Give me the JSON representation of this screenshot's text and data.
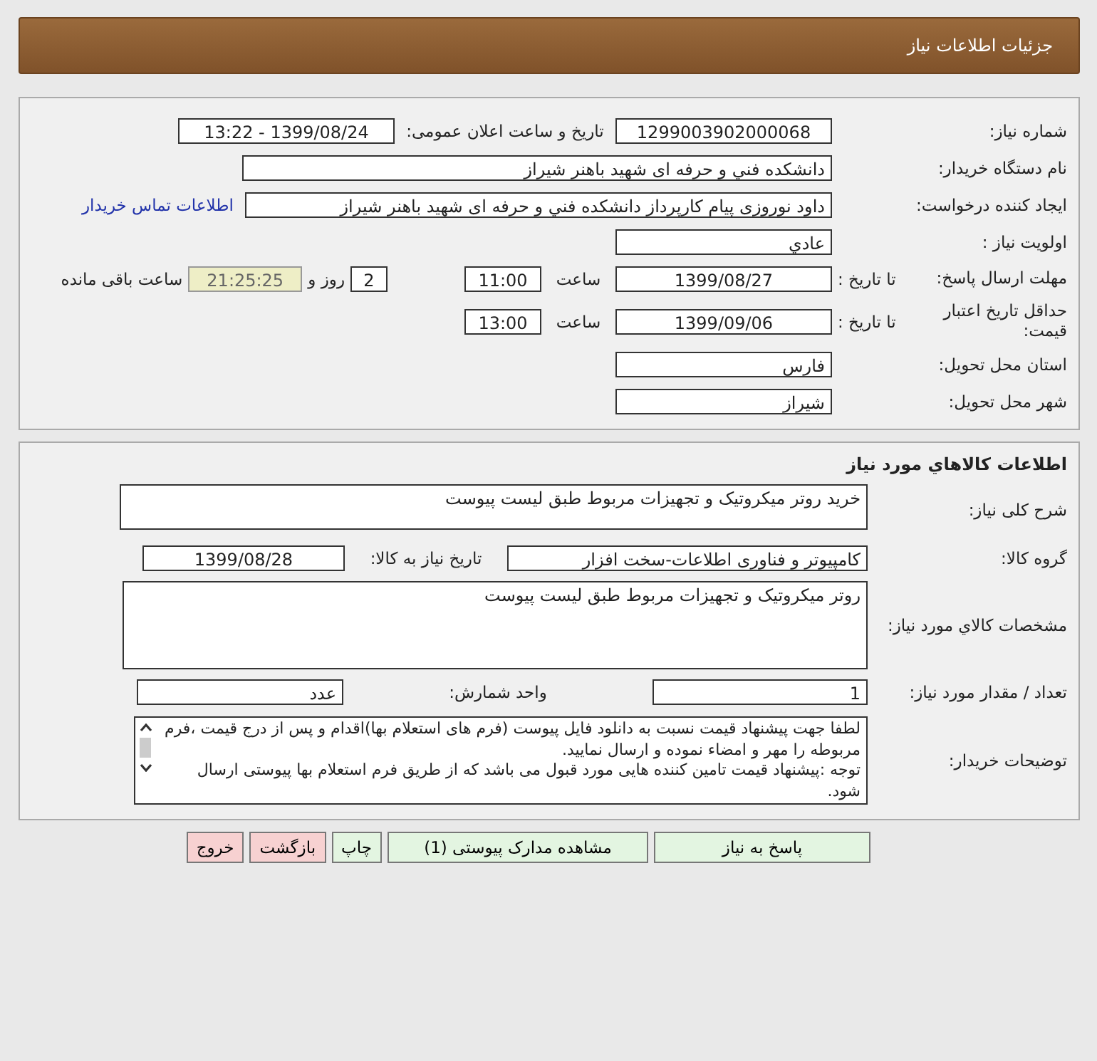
{
  "header": {
    "title": "جزئیات اطلاعات نیاز"
  },
  "details": {
    "need_number": {
      "label": "شماره نیاز:",
      "value": "1299003902000068"
    },
    "announce": {
      "label": "تاریخ و ساعت اعلان عمومی:",
      "value": "1399/08/24 - 13:22"
    },
    "buyer": {
      "label": "نام دستگاه خریدار:",
      "value": "دانشکده فني و حرفه ای شهید باهنر شیراز"
    },
    "creator": {
      "label": "ایجاد کننده درخواست:",
      "value": "داود نوروزی پیام کارپرداز دانشکده فني و حرفه ای شهید باهنر شیراز",
      "link": "اطلاعات تماس خریدار"
    },
    "priority": {
      "label": "اولویت نیاز :",
      "value": "عادي"
    },
    "deadline": {
      "label": "مهلت ارسال پاسخ:",
      "sublabel": "تا تاریخ :",
      "date": "1399/08/27",
      "time_label": "ساعت",
      "time": "11:00",
      "days": "2",
      "days_label": "روز و",
      "remaining": "21:25:25",
      "remaining_label": "ساعت باقی مانده"
    },
    "validity": {
      "label": "حداقل تاریخ اعتبار قیمت:",
      "sublabel": "تا تاریخ :",
      "date": "1399/09/06",
      "time_label": "ساعت",
      "time": "13:00"
    },
    "province": {
      "label": "استان محل تحویل:",
      "value": "فارس"
    },
    "city": {
      "label": "شهر محل تحویل:",
      "value": "شیراز"
    }
  },
  "goods": {
    "title": "اطلاعات کالاهاي مورد نیاز",
    "description": {
      "label": "شرح کلی نیاز:",
      "value": "خرید روتر میکروتیک و تجهیزات مربوط طبق لیست پیوست"
    },
    "group": {
      "label": "گروه کالا:",
      "value": "کامپیوتر و فناوری اطلاعات-سخت افزار"
    },
    "need_date": {
      "label": "تاریخ نیاز به کالا:",
      "value": "1399/08/28"
    },
    "specs": {
      "label": "مشخصات کالاي مورد نیاز:",
      "value": "روتر میکروتیک و تجهیزات مربوط طبق لیست پیوست"
    },
    "quantity": {
      "label": "تعداد / مقدار مورد نیاز:",
      "value": "1"
    },
    "unit": {
      "label": "واحد شمارش:",
      "value": "عدد"
    },
    "notes": {
      "label": "توضیحات خریدار:",
      "value": "لطفا جهت پیشنهاد قیمت نسبت به دانلود فایل پیوست (فرم های استعلام بها)اقدام و پس از درج قیمت ،فرم مربوطه را مهر و امضاء نموده و ارسال نمایید.\nتوجه :پیشنهاد قیمت تامین کننده هایی مورد قبول می باشد که از طریق فرم استعلام بها پیوستی ارسال شود."
    }
  },
  "buttons": [
    {
      "label": "پاسخ به نیاز",
      "kind": "primary"
    },
    {
      "label": "مشاهده مدارک پیوستی (1)",
      "kind": "primary"
    },
    {
      "label": "چاپ",
      "kind": "primary"
    },
    {
      "label": "بازگشت",
      "kind": "danger"
    },
    {
      "label": "خروج",
      "kind": "danger"
    }
  ]
}
